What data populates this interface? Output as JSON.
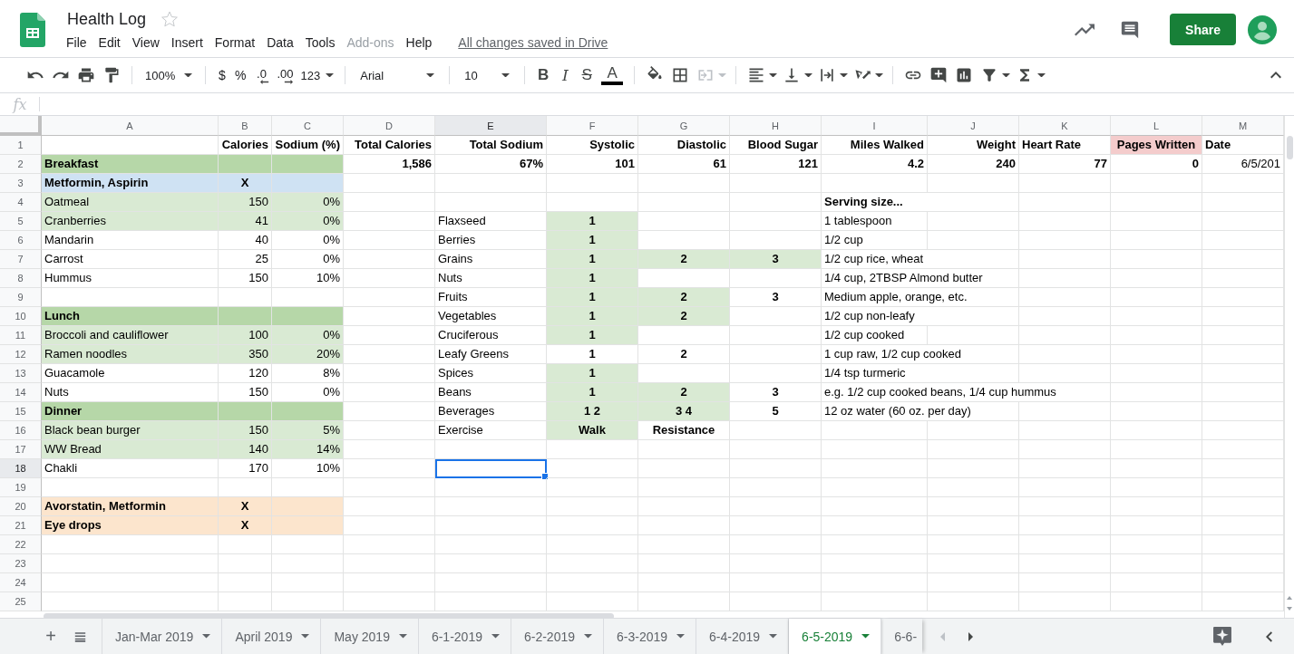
{
  "document": {
    "title": "Health Log",
    "starred": false,
    "save_status": "All changes saved in Drive"
  },
  "menus": [
    {
      "label": "File",
      "disabled": false
    },
    {
      "label": "Edit",
      "disabled": false
    },
    {
      "label": "View",
      "disabled": false
    },
    {
      "label": "Insert",
      "disabled": false
    },
    {
      "label": "Format",
      "disabled": false
    },
    {
      "label": "Data",
      "disabled": false
    },
    {
      "label": "Tools",
      "disabled": false
    },
    {
      "label": "Add-ons",
      "disabled": true
    },
    {
      "label": "Help",
      "disabled": false
    }
  ],
  "share_button": "Share",
  "toolbar": {
    "zoom": "100%",
    "currency": "$",
    "percent": "%",
    "decrease_decimals": ".0",
    "increase_decimals": ".00",
    "more_formats": "123",
    "font": "Arial",
    "font_size": "10",
    "bold": "B",
    "italic": "I",
    "strikethrough": "S",
    "text_color": "A"
  },
  "formula_bar": {
    "label": "fx"
  },
  "grid": {
    "columns": [
      {
        "letter": "A",
        "selected": false
      },
      {
        "letter": "B",
        "selected": false
      },
      {
        "letter": "C",
        "selected": false
      },
      {
        "letter": "D",
        "selected": false
      },
      {
        "letter": "E",
        "selected": true
      },
      {
        "letter": "F",
        "selected": false
      },
      {
        "letter": "G",
        "selected": false
      },
      {
        "letter": "H",
        "selected": false
      },
      {
        "letter": "I",
        "selected": false
      },
      {
        "letter": "J",
        "selected": false
      },
      {
        "letter": "K",
        "selected": false
      },
      {
        "letter": "L",
        "selected": false
      },
      {
        "letter": "M",
        "selected": false
      }
    ],
    "rows": [
      {
        "number": "1",
        "selected": false,
        "cells": {
          "B": {
            "text": "Calories",
            "kind": "total"
          },
          "C": {
            "text": "Sodium (%)",
            "kind": "total"
          },
          "D": {
            "text": "Total Calories",
            "kind": "total"
          },
          "E": {
            "text": "Total Sodium",
            "kind": "total"
          },
          "F": {
            "text": "Systolic",
            "kind": "total"
          },
          "G": {
            "text": "Diastolic",
            "kind": "total"
          },
          "H": {
            "text": "Blood Sugar",
            "kind": "total"
          },
          "I": {
            "text": "Miles Walked",
            "kind": "total"
          },
          "J": {
            "text": "Weight",
            "kind": "total"
          },
          "K": {
            "text": "Heart Rate",
            "kind": "title"
          },
          "L": {
            "text": "Pages Written",
            "kind": "tally",
            "color": "#f4cccc"
          },
          "M": {
            "text": "Date",
            "kind": "title"
          }
        }
      },
      {
        "number": "2",
        "selected": false,
        "cells": {
          "A": {
            "text": "Breakfast",
            "kind": "title",
            "color": "#b6d7a8"
          },
          "B": {
            "color": "#b6d7a8"
          },
          "C": {
            "color": "#b6d7a8"
          },
          "D": {
            "text": "1,586",
            "kind": "total"
          },
          "E": {
            "text": "67%",
            "kind": "total"
          },
          "F": {
            "text": "101",
            "kind": "total"
          },
          "G": {
            "text": "61",
            "kind": "total"
          },
          "H": {
            "text": "121",
            "kind": "total"
          },
          "I": {
            "text": "4.2",
            "kind": "total"
          },
          "J": {
            "text": "240",
            "kind": "total"
          },
          "K": {
            "text": "77",
            "kind": "total"
          },
          "L": {
            "text": "0",
            "kind": "total"
          },
          "M": {
            "text": "6/5/201",
            "kind": "figure"
          }
        }
      },
      {
        "number": "3",
        "selected": false,
        "cells": {
          "A": {
            "text": "Metformin, Aspirin",
            "kind": "title",
            "color": "#cfe2f3"
          },
          "B": {
            "text": "X",
            "kind": "tally",
            "color": "#cfe2f3"
          },
          "C": {
            "color": "#cfe2f3"
          }
        }
      },
      {
        "number": "4",
        "selected": false,
        "cells": {
          "A": {
            "text": "Oatmeal",
            "kind": "label",
            "color": "#d9ead3"
          },
          "B": {
            "text": "150",
            "kind": "figure",
            "color": "#d9ead3"
          },
          "C": {
            "text": "0%",
            "kind": "figure",
            "color": "#d9ead3"
          },
          "I": {
            "text": "Serving size...",
            "kind": "title"
          }
        }
      },
      {
        "number": "5",
        "selected": false,
        "cells": {
          "A": {
            "text": "Cranberries",
            "kind": "label",
            "color": "#d9ead3"
          },
          "B": {
            "text": "41",
            "kind": "figure",
            "color": "#d9ead3"
          },
          "C": {
            "text": "0%",
            "kind": "figure",
            "color": "#d9ead3"
          },
          "E": {
            "text": "Flaxseed",
            "kind": "label"
          },
          "F": {
            "text": "1",
            "kind": "tally",
            "color": "#d9ead3"
          },
          "I": {
            "text": "1 tablespoon",
            "kind": "label"
          }
        }
      },
      {
        "number": "6",
        "selected": false,
        "cells": {
          "A": {
            "text": "Mandarin",
            "kind": "label"
          },
          "B": {
            "text": "40",
            "kind": "figure"
          },
          "C": {
            "text": "0%",
            "kind": "figure"
          },
          "E": {
            "text": "Berries",
            "kind": "label"
          },
          "F": {
            "text": "1",
            "kind": "tally",
            "color": "#d9ead3"
          },
          "I": {
            "text": "1/2 cup",
            "kind": "label"
          }
        }
      },
      {
        "number": "7",
        "selected": false,
        "cells": {
          "A": {
            "text": "Carrost",
            "kind": "label"
          },
          "B": {
            "text": "25",
            "kind": "figure"
          },
          "C": {
            "text": "0%",
            "kind": "figure"
          },
          "E": {
            "text": "Grains",
            "kind": "label"
          },
          "F": {
            "text": "1",
            "kind": "tally",
            "color": "#d9ead3"
          },
          "G": {
            "text": "2",
            "kind": "tally",
            "color": "#d9ead3"
          },
          "H": {
            "text": "3",
            "kind": "tally",
            "color": "#d9ead3"
          },
          "I": {
            "text": "1/2 cup rice, wheat",
            "kind": "label"
          }
        }
      },
      {
        "number": "8",
        "selected": false,
        "cells": {
          "A": {
            "text": "Hummus",
            "kind": "label"
          },
          "B": {
            "text": "150",
            "kind": "figure"
          },
          "C": {
            "text": "10%",
            "kind": "figure"
          },
          "E": {
            "text": "Nuts",
            "kind": "label"
          },
          "F": {
            "text": "1",
            "kind": "tally",
            "color": "#d9ead3"
          },
          "I": {
            "text": "1/4 cup, 2TBSP Almond butter",
            "kind": "label"
          }
        }
      },
      {
        "number": "9",
        "selected": false,
        "cells": {
          "E": {
            "text": "Fruits",
            "kind": "label"
          },
          "F": {
            "text": "1",
            "kind": "tally",
            "color": "#d9ead3"
          },
          "G": {
            "text": "2",
            "kind": "tally",
            "color": "#d9ead3"
          },
          "H": {
            "text": "3",
            "kind": "tally"
          },
          "I": {
            "text": "Medium apple, orange, etc.",
            "kind": "label"
          }
        }
      },
      {
        "number": "10",
        "selected": false,
        "cells": {
          "A": {
            "text": "Lunch",
            "kind": "title",
            "color": "#b6d7a8"
          },
          "B": {
            "color": "#b6d7a8"
          },
          "C": {
            "color": "#b6d7a8"
          },
          "E": {
            "text": "Vegetables",
            "kind": "label"
          },
          "F": {
            "text": "1",
            "kind": "tally",
            "color": "#d9ead3"
          },
          "G": {
            "text": "2",
            "kind": "tally",
            "color": "#d9ead3"
          },
          "I": {
            "text": "1/2 cup non-leafy",
            "kind": "label"
          }
        }
      },
      {
        "number": "11",
        "selected": false,
        "cells": {
          "A": {
            "text": "Broccoli and cauliflower",
            "kind": "label",
            "color": "#d9ead3"
          },
          "B": {
            "text": "100",
            "kind": "figure",
            "color": "#d9ead3"
          },
          "C": {
            "text": "0%",
            "kind": "figure",
            "color": "#d9ead3"
          },
          "E": {
            "text": "Cruciferous",
            "kind": "label"
          },
          "F": {
            "text": "1",
            "kind": "tally",
            "color": "#d9ead3"
          },
          "I": {
            "text": "1/2 cup cooked",
            "kind": "label"
          }
        }
      },
      {
        "number": "12",
        "selected": false,
        "cells": {
          "A": {
            "text": "Ramen noodles",
            "kind": "label",
            "color": "#d9ead3"
          },
          "B": {
            "text": "350",
            "kind": "figure",
            "color": "#d9ead3"
          },
          "C": {
            "text": "20%",
            "kind": "figure",
            "color": "#d9ead3"
          },
          "E": {
            "text": "Leafy Greens",
            "kind": "label"
          },
          "F": {
            "text": "1",
            "kind": "tally"
          },
          "G": {
            "text": "2",
            "kind": "tally"
          },
          "I": {
            "text": "1 cup raw, 1/2 cup cooked",
            "kind": "label"
          }
        }
      },
      {
        "number": "13",
        "selected": false,
        "cells": {
          "A": {
            "text": "Guacamole",
            "kind": "label"
          },
          "B": {
            "text": "120",
            "kind": "figure"
          },
          "C": {
            "text": "8%",
            "kind": "figure"
          },
          "E": {
            "text": "Spices",
            "kind": "label"
          },
          "F": {
            "text": "1",
            "kind": "tally",
            "color": "#d9ead3"
          },
          "I": {
            "text": "1/4 tsp turmeric",
            "kind": "label"
          }
        }
      },
      {
        "number": "14",
        "selected": false,
        "cells": {
          "A": {
            "text": "Nuts",
            "kind": "label"
          },
          "B": {
            "text": "150",
            "kind": "figure"
          },
          "C": {
            "text": "0%",
            "kind": "figure"
          },
          "E": {
            "text": "Beans",
            "kind": "label"
          },
          "F": {
            "text": "1",
            "kind": "tally",
            "color": "#d9ead3"
          },
          "G": {
            "text": "2",
            "kind": "tally",
            "color": "#d9ead3"
          },
          "H": {
            "text": "3",
            "kind": "tally"
          },
          "I": {
            "text": "e.g. 1/2 cup cooked beans, 1/4 cup hummus",
            "kind": "label"
          }
        }
      },
      {
        "number": "15",
        "selected": false,
        "cells": {
          "A": {
            "text": "Dinner",
            "kind": "title",
            "color": "#b6d7a8"
          },
          "B": {
            "color": "#b6d7a8"
          },
          "C": {
            "color": "#b6d7a8"
          },
          "E": {
            "text": "Beverages",
            "kind": "label"
          },
          "F": {
            "text": "1 2",
            "kind": "tally",
            "color": "#d9ead3"
          },
          "G": {
            "text": "3 4",
            "kind": "tally",
            "color": "#d9ead3"
          },
          "H": {
            "text": "5",
            "kind": "tally"
          },
          "I": {
            "text": "12 oz water (60 oz. per day)",
            "kind": "label"
          }
        }
      },
      {
        "number": "16",
        "selected": false,
        "cells": {
          "A": {
            "text": "Black bean burger",
            "kind": "label",
            "color": "#d9ead3"
          },
          "B": {
            "text": "150",
            "kind": "figure",
            "color": "#d9ead3"
          },
          "C": {
            "text": "5%",
            "kind": "figure",
            "color": "#d9ead3"
          },
          "E": {
            "text": "Exercise",
            "kind": "label"
          },
          "F": {
            "text": "Walk",
            "kind": "tally",
            "color": "#d9ead3"
          },
          "G": {
            "text": "Resistance",
            "kind": "tally"
          }
        }
      },
      {
        "number": "17",
        "selected": false,
        "cells": {
          "A": {
            "text": "WW Bread",
            "kind": "label",
            "color": "#d9ead3"
          },
          "B": {
            "text": "140",
            "kind": "figure",
            "color": "#d9ead3"
          },
          "C": {
            "text": "14%",
            "kind": "figure",
            "color": "#d9ead3"
          }
        }
      },
      {
        "number": "18",
        "selected": true,
        "cells": {
          "A": {
            "text": "Chakli",
            "kind": "label"
          },
          "B": {
            "text": "170",
            "kind": "figure"
          },
          "C": {
            "text": "10%",
            "kind": "figure"
          }
        }
      },
      {
        "number": "19",
        "selected": false
      },
      {
        "number": "20",
        "selected": false,
        "cells": {
          "A": {
            "text": "Avorstatin, Metformin",
            "kind": "title",
            "color": "#fce5cd"
          },
          "B": {
            "text": "X",
            "kind": "tally",
            "color": "#fce5cd"
          },
          "C": {
            "color": "#fce5cd"
          }
        }
      },
      {
        "number": "21",
        "selected": false,
        "cells": {
          "A": {
            "text": "Eye drops",
            "kind": "title",
            "color": "#fce5cd"
          },
          "B": {
            "text": "X",
            "kind": "tally",
            "color": "#fce5cd"
          },
          "C": {
            "color": "#fce5cd"
          }
        }
      },
      {
        "number": "22",
        "selected": false
      },
      {
        "number": "23",
        "selected": false
      },
      {
        "number": "24",
        "selected": false
      },
      {
        "number": "25",
        "selected": false
      }
    ]
  },
  "sheet_tabs": {
    "add_button": "+",
    "tabs": [
      {
        "label": "Jan-Mar 2019",
        "selected": false,
        "kind": "full"
      },
      {
        "label": "April 2019",
        "selected": false,
        "kind": "full"
      },
      {
        "label": "May 2019",
        "selected": false,
        "kind": "full"
      },
      {
        "label": "6-1-2019",
        "selected": false,
        "kind": "full"
      },
      {
        "label": "6-2-2019",
        "selected": false,
        "kind": "full"
      },
      {
        "label": "6-3-2019",
        "selected": false,
        "kind": "full"
      },
      {
        "label": "6-4-2019",
        "selected": false,
        "kind": "full"
      },
      {
        "label": "6-5-2019",
        "selected": true,
        "kind": "full"
      },
      {
        "label": "6-6-",
        "selected": false,
        "kind": "cut"
      }
    ]
  }
}
